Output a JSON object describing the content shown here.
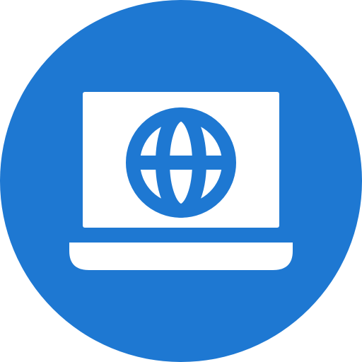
{
  "icon": {
    "name": "laptop-globe-icon",
    "colors": {
      "background": "#1E78D2",
      "foreground": "#FFFFFF"
    }
  }
}
